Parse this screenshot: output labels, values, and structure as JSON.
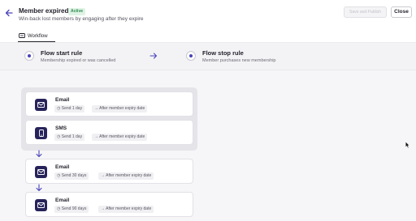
{
  "header": {
    "title": "Member expired",
    "status_badge": "Active",
    "subtitle": "Win-back lost members by engaging after they expire",
    "save_label": "Save and Publish",
    "close_label": "Close",
    "tab_label": "Workflow"
  },
  "rules": {
    "start": {
      "title": "Flow start rule",
      "description": "Membership expired or was cancelled"
    },
    "stop": {
      "title": "Flow stop rule",
      "description": "Member purchases new membership"
    }
  },
  "steps": [
    {
      "type": "Email",
      "delay": "Send 1 day",
      "timing": "After member expiry date",
      "icon": "mail-icon"
    },
    {
      "type": "SMS",
      "delay": "Send 1 day",
      "timing": "After member expiry date",
      "icon": "phone-icon"
    },
    {
      "type": "Email",
      "delay": "Send 30 days",
      "timing": "After member expiry date",
      "icon": "mail-icon"
    },
    {
      "type": "Email",
      "delay": "Send 90 days",
      "timing": "After member expiry date",
      "icon": "mail-icon"
    }
  ],
  "colors": {
    "accent": "#4a43b8",
    "icon_bg": "#27235a",
    "badge_bg": "#dff3e5",
    "badge_text": "#2d8a4e"
  }
}
